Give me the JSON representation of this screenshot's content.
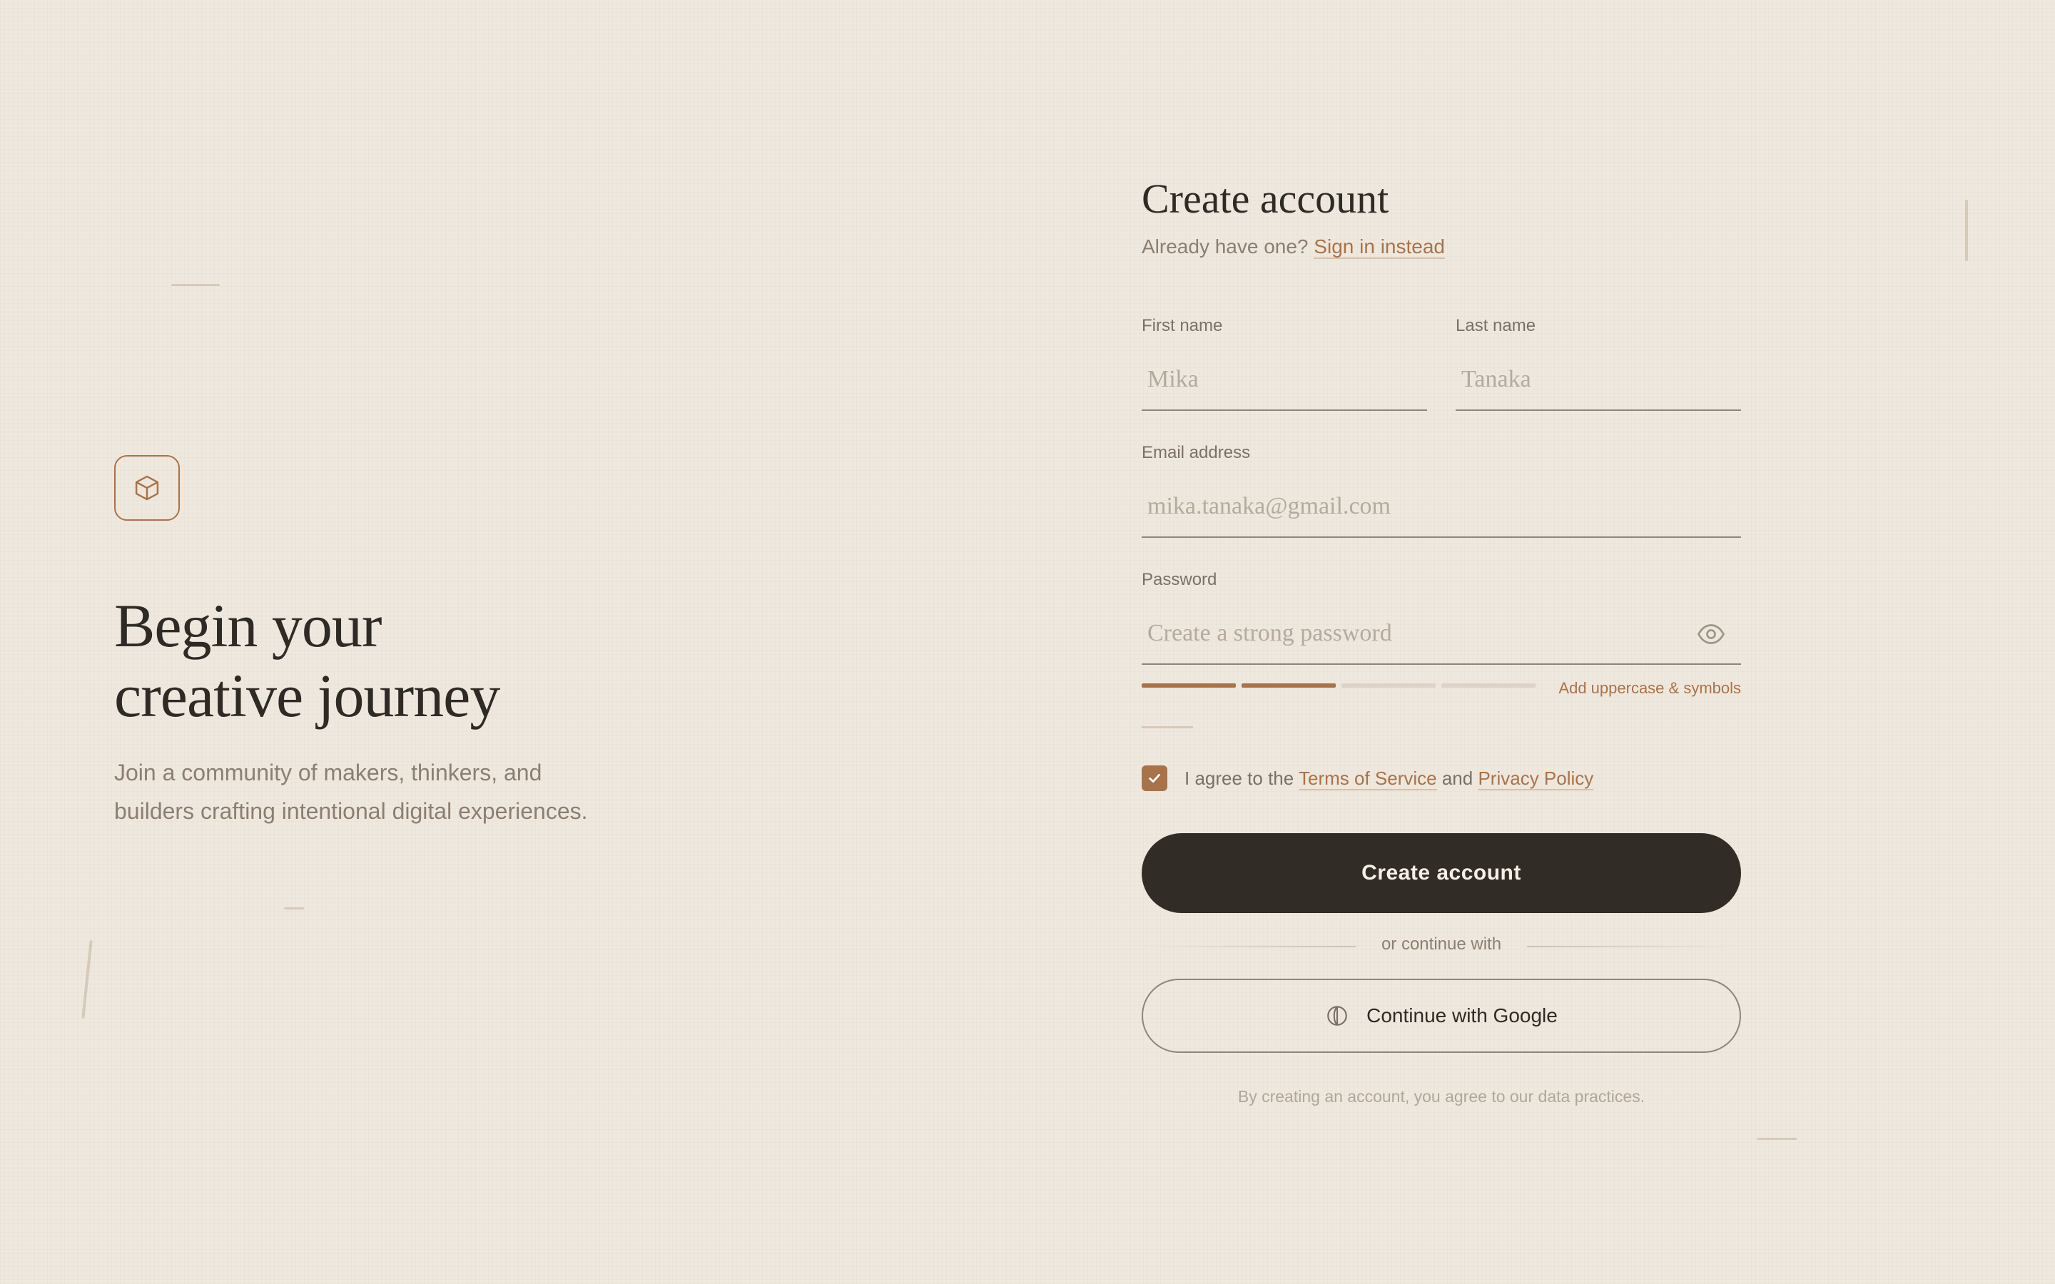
{
  "hero": {
    "logo_icon": "cube-icon",
    "headline_line1": "Begin your",
    "headline_line2": "creative journey",
    "subtext": "Join a community of makers, thinkers, and builders crafting intentional digital experiences."
  },
  "form": {
    "title": "Create account",
    "signin_prompt": "Already have one?",
    "signin_link": "Sign in instead",
    "first_name": {
      "label": "First name",
      "placeholder": "Mika",
      "value": ""
    },
    "last_name": {
      "label": "Last name",
      "placeholder": "Tanaka",
      "value": ""
    },
    "email": {
      "label": "Email address",
      "placeholder": "mika.tanaka@gmail.com",
      "value": ""
    },
    "password": {
      "label": "Password",
      "placeholder": "Create a strong password",
      "value": "",
      "toggle_icon": "eye-icon"
    },
    "strength": {
      "filled": 2,
      "total": 4,
      "hint": "Add uppercase & symbols"
    },
    "agree": {
      "checked": true,
      "prefix": "I agree to the",
      "terms": "Terms of Service",
      "and": "and",
      "privacy": "Privacy Policy"
    },
    "submit_label": "Create account",
    "divider_label": "or continue with",
    "google_label": "Continue with Google",
    "google_icon": "globe-icon",
    "footnote": "By creating an account, you agree to our data practices."
  },
  "colors": {
    "background": "#efe8de",
    "accent": "#a8734a",
    "dark": "#322c26",
    "muted_text": "#8b7f72"
  }
}
